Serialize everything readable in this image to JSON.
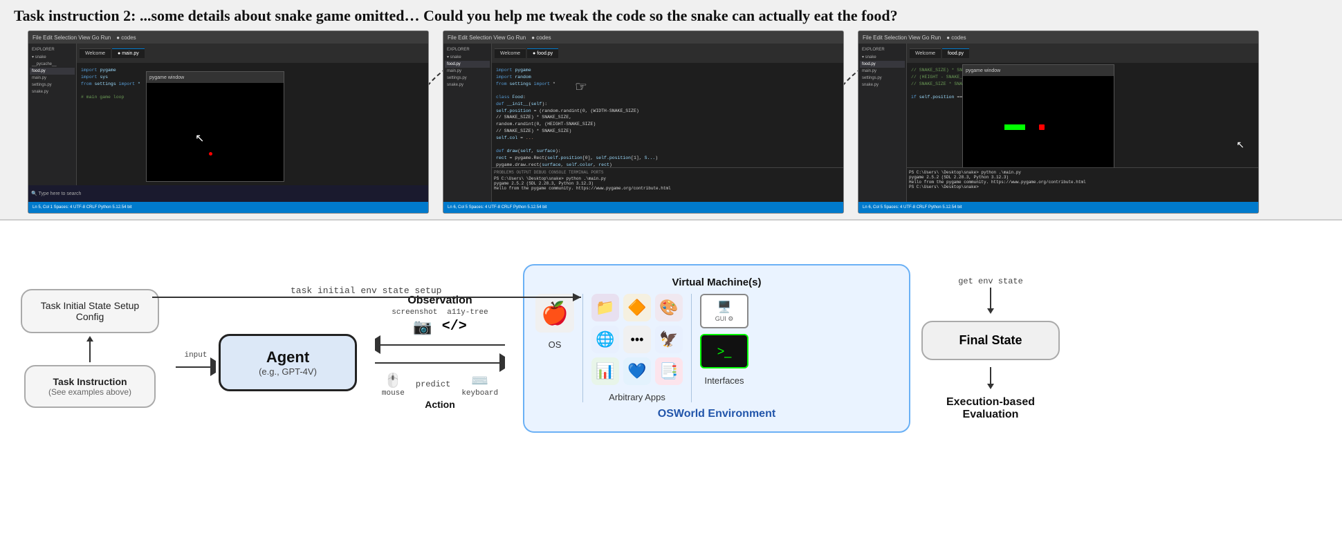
{
  "title": {
    "text": "Task instruction 2: ...some details about snake game omitted… Could you help me tweak the code so the snake can actually eat the food?"
  },
  "screenshots": [
    {
      "id": "ss1",
      "tabs": [
        "Welcome",
        "main.py"
      ],
      "sidebar_items": [
        "EXPLORER",
        "pycache_",
        "food.py",
        "main.py",
        "settings.py",
        "snake.py"
      ],
      "has_game_window": true,
      "game_window_label": "pygame window"
    },
    {
      "id": "ss2",
      "tabs": [
        "Welcome",
        "food.py"
      ],
      "sidebar_items": [
        "EXPLORER",
        "food.py",
        "main.py",
        "settings.py",
        "snake.py"
      ],
      "has_game_window": false,
      "code_visible": true
    },
    {
      "id": "ss3",
      "tabs": [
        "Welcome",
        "food.py"
      ],
      "sidebar_items": [
        "EXPLORER",
        "food.py",
        "main.py",
        "settings.py",
        "snake.py"
      ],
      "has_game_window": true,
      "game_window_label": "pygame window (with snake)"
    }
  ],
  "flow": {
    "task_initial_box": "Task Initial State Setup Config",
    "task_instruction_box": "Task Instruction\n(See examples above)",
    "input_label": "input",
    "agent_title": "Agent",
    "agent_subtitle": "(e.g., GPT-4V)",
    "task_initial_env_label": "task initial env state setup",
    "observation_title": "Observation",
    "screenshot_label": "screenshot",
    "ally_tree_label": "a11y-tree",
    "predict_label": "predict",
    "mouse_label": "mouse",
    "keyboard_label": "keyboard",
    "action_label": "Action",
    "vm_label": "Virtual Machine(s)",
    "os_label": "OS",
    "apps_label": "Arbitrary Apps",
    "interfaces_label": "Interfaces",
    "osworld_label": "OSWorld Environment",
    "get_env_state_label": "get env state",
    "final_state_label": "Final State",
    "evaluation_label": "Execution-based\nEvaluation"
  },
  "colors": {
    "accent_blue": "#2255aa",
    "env_box_border": "#6ab0f5",
    "env_box_bg": "#eaf3ff",
    "agent_box_bg": "#dce8f7",
    "arrow_color": "#333333",
    "os_world_label_color": "#2255aa"
  }
}
